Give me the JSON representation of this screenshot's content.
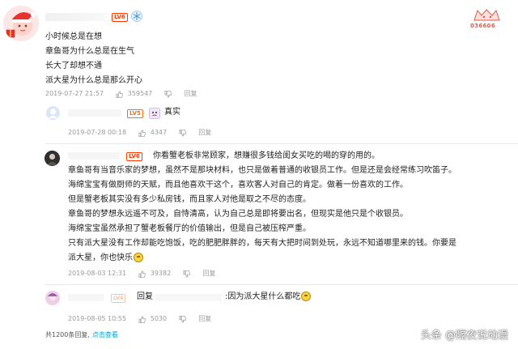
{
  "badge": {
    "number": "036606"
  },
  "comments": [
    {
      "level": "LV6",
      "lines": [
        "小时候总是在想",
        "章鱼哥为什么总是在生气",
        "长大了却想不通",
        "派大星为什么总是那么开心"
      ],
      "date": "2019-07-27 21:57",
      "likes": "359547",
      "reply_label": "回复"
    },
    {
      "level": "LV5",
      "text": "真实",
      "date": "2019-07-28 00:18",
      "likes": "4347",
      "reply_label": "回复"
    },
    {
      "level": "LV6",
      "lines": [
        "你看蟹老板非常顾家，想赚很多钱给闺女买吃的喝的穿的用的。",
        "章鱼哥有当音乐家的梦想，虽然不是那块材料，也只是做着普通的收银员工作。但是还是会经常练习吹笛子。",
        "海绵宝宝有做厨师的天赋，而且他喜欢干这个，喜欢客人对自己的肯定。做着一份喜欢的工作。",
        "但是蟹老板其实没有多少私房钱，而且家人对他是取之不尽的态度。",
        "章鱼哥的梦想永远遥不可及，自恃清高，认为自己总是即将要出名，但现实是他只是个收银员。",
        "海绵宝宝虽然承担了蟹老板餐厅的价值输出，但是自己被压榨严重。",
        "只有派大星没有工作却能吃饱饭，吃的肥肥胖胖的，每天有大把时间到处玩，永远不知道哪里来的钱。你要是",
        "派大星，你也快乐"
      ],
      "date": "2019-08-03 12:31",
      "likes": "39382",
      "reply_label": "回复"
    },
    {
      "level": "LV4",
      "reply_prefix": "回复",
      "text": ":因为派大星什么都吃",
      "date": "2019-08-05 10:55",
      "likes": "5030",
      "reply_label": "回复"
    }
  ],
  "footer": {
    "count_text": "共1200条回复,",
    "link_text": "点击查看"
  },
  "watermark": "头条 @隔夜说动漫",
  "colors": {
    "accent": "#00a1d6",
    "level_red": "#ff3a00",
    "meta_gray": "#9a9a9a"
  }
}
